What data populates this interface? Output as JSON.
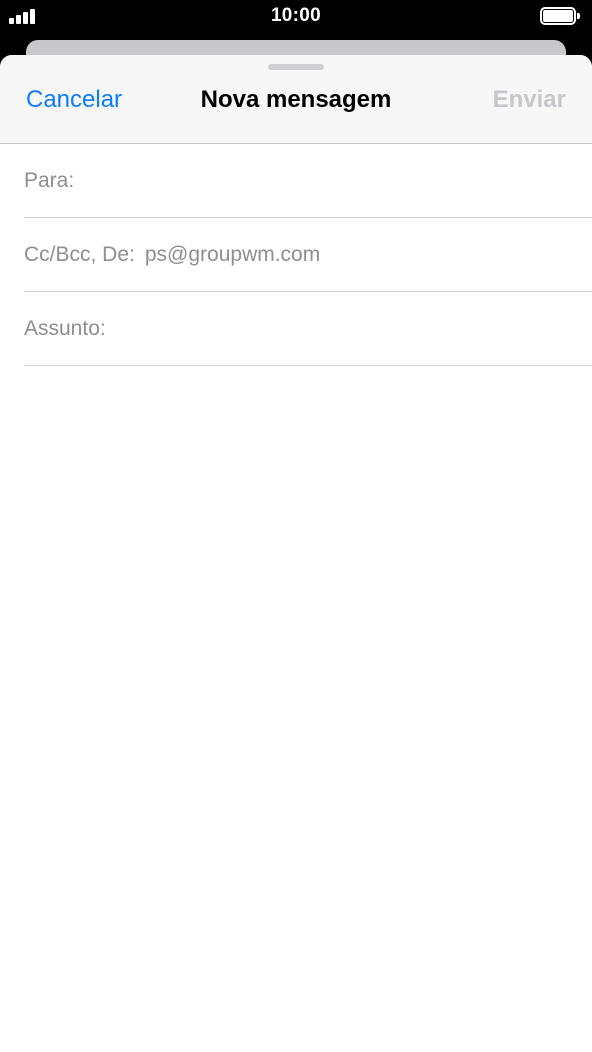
{
  "status_bar": {
    "time": "10:00",
    "signal_icon": "cellular-signal-icon",
    "battery_icon": "battery-icon"
  },
  "nav": {
    "cancel_label": "Cancelar",
    "title": "Nova mensagem",
    "send_label": "Enviar"
  },
  "fields": {
    "to_label": "Para:",
    "ccbcc_label": "Cc/Bcc, De:",
    "from_value": "ps@groupwm.com",
    "subject_label": "Assunto:"
  },
  "colors": {
    "accent": "#0a7bff",
    "disabled": "#c7c7cc",
    "secondary_text": "#8e8e93"
  }
}
